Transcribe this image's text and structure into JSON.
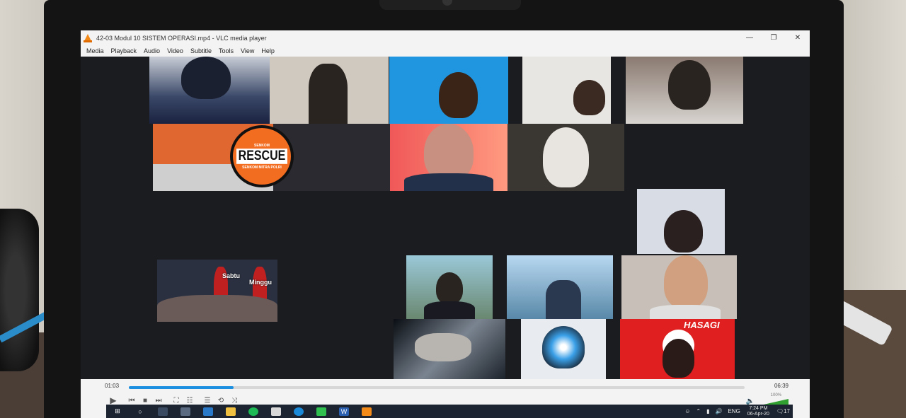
{
  "window": {
    "title": "42-03 Modul 10 SISTEM OPERASI.mp4 - VLC media player",
    "minimize_glyph": "—",
    "maximize_glyph": "❐",
    "close_glyph": "✕"
  },
  "menu": {
    "items": [
      "Media",
      "Playback",
      "Audio",
      "Video",
      "Subtitle",
      "Tools",
      "View",
      "Help"
    ]
  },
  "video": {
    "rescue_logo": {
      "top_text": "SENKOM",
      "main_text": "RESCUE",
      "bottom_text": "SENKOM MITRA POLRI"
    },
    "meme_tile": {
      "label_left": "Sabtu",
      "label_right": "Minggu"
    },
    "flag_tile": {
      "text": "HASAGI"
    }
  },
  "player": {
    "current_time": "01:03",
    "total_time": "06:39",
    "progress_fraction": 0.17,
    "volume_label": "100%",
    "volume_fraction": 1.0
  },
  "taskbar": {
    "language": "ENG",
    "time": "7:24 PM",
    "date": "06-Apr-20",
    "notification_count": "17"
  }
}
